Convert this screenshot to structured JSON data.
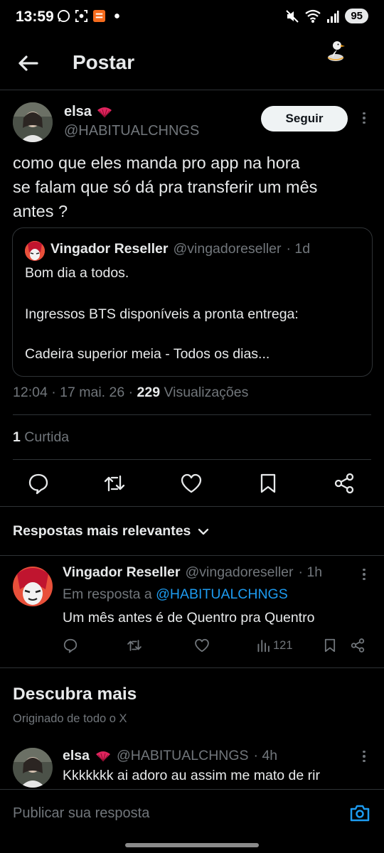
{
  "status_bar": {
    "time": "13:59",
    "battery": "95"
  },
  "header": {
    "title": "Postar"
  },
  "tweet": {
    "author_name": "elsa",
    "author_handle": "@HABITUALCHNGS",
    "follow_label": "Seguir",
    "text_lines": [
      "como que eles manda pro app na hora",
      "se falam que só dá pra transferir um mês",
      "antes ?"
    ],
    "quote": {
      "name": "Vingador Reseller",
      "handle": "@vingadoreseller",
      "age": "· 1d",
      "lines": [
        "Bom dia a todos.",
        "Ingressos BTS disponíveis a pronta entrega:",
        "Cadeira superior meia - Todos os dias..."
      ]
    },
    "time": "12:04 · 17 mai. 26 · ",
    "views_count": "229",
    "views_label": " Visualizações",
    "likes_count": "1",
    "likes_label": " Curtida"
  },
  "replies_sort": {
    "label": "Respostas mais relevantes"
  },
  "reply": {
    "name": "Vingador Reseller",
    "handle": "@vingadoreseller",
    "age": "· 1h",
    "in_reply_prefix": "Em resposta a ",
    "in_reply_handle": "@HABITUALCHNGS",
    "text": "Um mês antes é de Quentro pra Quentro",
    "views": "121"
  },
  "discover": {
    "title": "Descubra mais",
    "subtitle": "Originado de todo o X"
  },
  "discover_item": {
    "name": "elsa",
    "handle": "@HABITUALCHNGS",
    "age": "· 4h",
    "text": "Kkkkkkk ai adoro au assim me mato de rir"
  },
  "composer": {
    "placeholder": "Publicar sua resposta"
  },
  "icons": {
    "back": "back-arrow-icon",
    "fan": "fan-emoji-icon",
    "duck": "duck-icon",
    "reply": "reply-icon",
    "retweet": "retweet-icon",
    "like": "heart-icon",
    "bookmark": "bookmark-icon",
    "share": "share-icon",
    "views": "views-icon",
    "camera": "camera-icon"
  },
  "colors": {
    "background": "#000000",
    "text": "#e7e9ea",
    "muted": "#71767b",
    "accent": "#1d9bf0",
    "divider": "#2f3336"
  }
}
